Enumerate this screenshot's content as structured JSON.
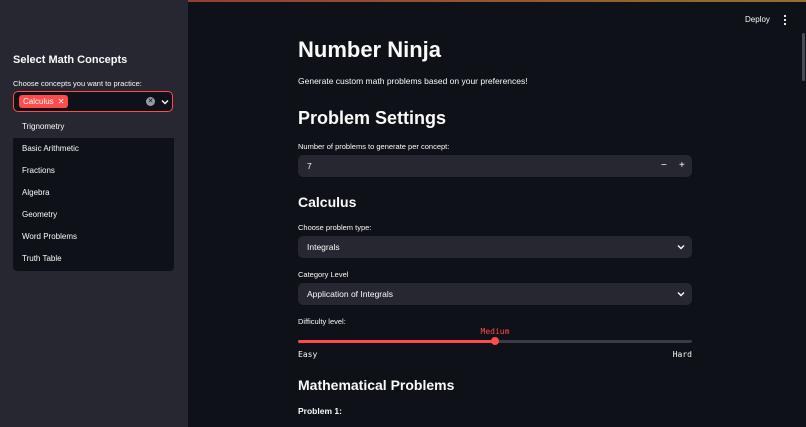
{
  "header": {
    "deploy_label": "Deploy"
  },
  "sidebar": {
    "title": "Select Math Concepts",
    "multiselect": {
      "label": "Choose concepts you want to practice:",
      "selected": [
        "Calculus"
      ],
      "options": [
        "Trignometry",
        "Basic Arithmetic",
        "Fractions",
        "Algebra",
        "Geometry",
        "Word Problems",
        "Truth Table"
      ]
    }
  },
  "main": {
    "title": "Number Ninja",
    "intro": "Generate custom math problems based on your preferences!",
    "settings_heading": "Problem Settings",
    "num_problems": {
      "label": "Number of problems to generate per concept:",
      "value": "7",
      "minus": "−",
      "plus": "+"
    },
    "concept_heading": "Calculus",
    "problem_type": {
      "label": "Choose problem type:",
      "value": "Integrals"
    },
    "category_level": {
      "label": "Category Level",
      "value": "Application of Integrals"
    },
    "difficulty": {
      "label": "Difficulty level:",
      "value": "Medium",
      "min_label": "Easy",
      "max_label": "Hard",
      "position": 0.5
    },
    "problems_heading": "Mathematical Problems",
    "problem1_label": "Problem 1:"
  },
  "colors": {
    "accent": "#ff4b4b",
    "background": "#0e1117",
    "sidebar": "#262730"
  }
}
